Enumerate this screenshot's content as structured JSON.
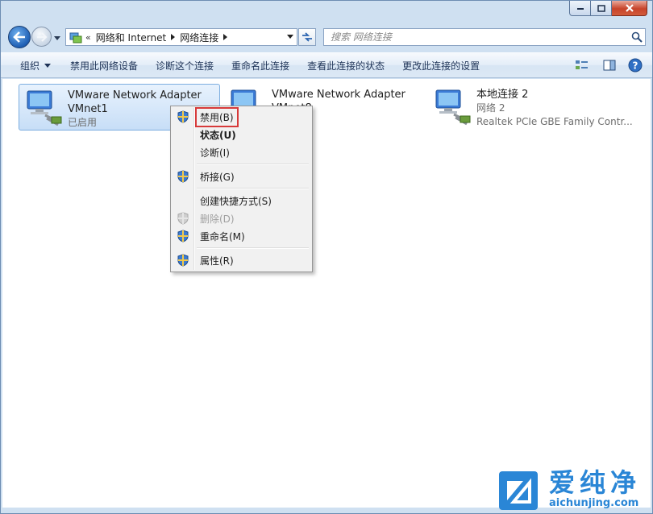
{
  "address": {
    "crumb_chevron": "«",
    "crumbs": [
      "网络和 Internet",
      "网络连接"
    ]
  },
  "search": {
    "placeholder": "搜索 网络连接"
  },
  "commands": {
    "organize": "组织",
    "disable_device": "禁用此网络设备",
    "diagnose": "诊断这个连接",
    "rename": "重命名此连接",
    "view_status": "查看此连接的状态",
    "change_settings": "更改此连接的设置"
  },
  "connections": [
    {
      "name": "VMware Network Adapter",
      "device": "VMnet1",
      "status": "已启用"
    },
    {
      "name": "VMware Network Adapter",
      "device": "VMnet8",
      "status": ""
    },
    {
      "name": "本地连接 2",
      "device": "网络  2",
      "status": "Realtek PCIe GBE Family Contr..."
    }
  ],
  "context_menu": {
    "disable": "禁用(B)",
    "status": "状态(U)",
    "diagnose": "诊断(I)",
    "bridge": "桥接(G)",
    "shortcut": "创建快捷方式(S)",
    "delete": "删除(D)",
    "rename": "重命名(M)",
    "properties": "属性(R)"
  },
  "watermark": {
    "brand_cn": "爱纯净",
    "brand_url": "aichunjing.com"
  },
  "colors": {
    "accent": "#2a86d6",
    "highlight_box": "#d73a3a",
    "selection": "#c7def7"
  }
}
